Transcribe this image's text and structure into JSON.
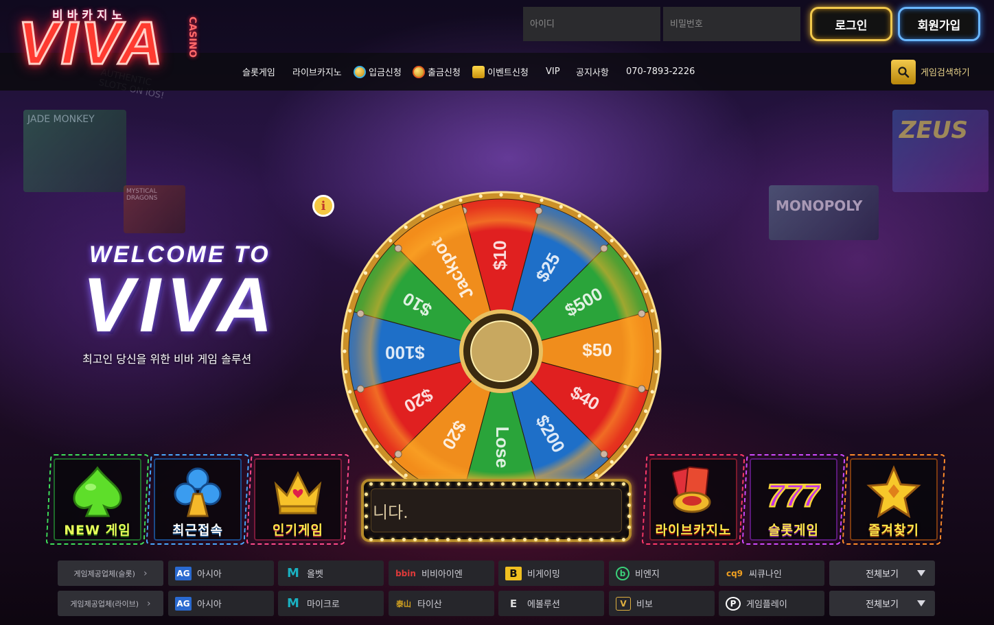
{
  "logo": {
    "title": "VIVA",
    "sub": "비바카지노",
    "casino": "CASINO"
  },
  "login": {
    "id_placeholder": "아이디",
    "pw_placeholder": "비밀번호",
    "login_label": "로그인",
    "join_label": "회원가입"
  },
  "nav": {
    "items": [
      "슬롯게임",
      "라이브카지노",
      "입금신청",
      "출금신청",
      "이벤트신청",
      "VIP",
      "공지사항",
      "070-7893-2226"
    ],
    "search_label": "게임검색하기"
  },
  "hero": {
    "welcome": "WELCOME TO",
    "title": "VIVA",
    "subtitle": "최고인 당신을 위한 비바 게임 솔루션"
  },
  "wheel": {
    "segments": [
      "$10",
      "$25",
      "$500",
      "$50",
      "$40",
      "$200",
      "Lose",
      "$20",
      "$20",
      "$100",
      "$10",
      "Jackpot"
    ],
    "colors": [
      "#e02020",
      "#1e6fc8",
      "#2aa43a",
      "#f08d1c"
    ]
  },
  "marquee": {
    "text": "니다."
  },
  "cards": [
    {
      "label": "NEW 게임",
      "icon": "spade-icon",
      "color": "#3ee05a"
    },
    {
      "label": "최근접속",
      "icon": "club-icon",
      "color": "#4aa8ff"
    },
    {
      "label": "인기게임",
      "icon": "crown-icon",
      "color": "#ff4a8a"
    },
    {
      "label": "라이브카지노",
      "icon": "cards-chip-icon",
      "color": "#ff3a6a"
    },
    {
      "label": "슬롯게임",
      "icon": "777-icon",
      "color": "#d04aff"
    },
    {
      "label": "즐겨찾기",
      "icon": "star-icon",
      "color": "#ff8a2a"
    }
  ],
  "providers": {
    "row1_label": "게임제공업체(슬롯)",
    "row2_label": "게임제공업체(라이브)",
    "row1": [
      {
        "name": "아시아",
        "icon": "AG"
      },
      {
        "name": "올벳",
        "icon": "M"
      },
      {
        "name": "비비아이엔",
        "icon": "bbin"
      },
      {
        "name": "비게이밍",
        "icon": "B"
      },
      {
        "name": "비엔지",
        "icon": "b"
      },
      {
        "name": "씨큐나인",
        "icon": "cq9"
      }
    ],
    "row2": [
      {
        "name": "아시아",
        "icon": "AG"
      },
      {
        "name": "마이크로",
        "icon": "M"
      },
      {
        "name": "타이산",
        "icon": "泰山"
      },
      {
        "name": "에볼루션",
        "icon": "E"
      },
      {
        "name": "비보",
        "icon": "V"
      },
      {
        "name": "게임플레이",
        "icon": "P"
      }
    ],
    "view_all": "전체보기"
  },
  "background": {
    "signs": [
      "MONOPOLY",
      "ZEUS",
      "MYSTICAL DRAGONS",
      "JADE MONKEY",
      "AUTHENTIC SLOTS ON iOS!"
    ]
  }
}
